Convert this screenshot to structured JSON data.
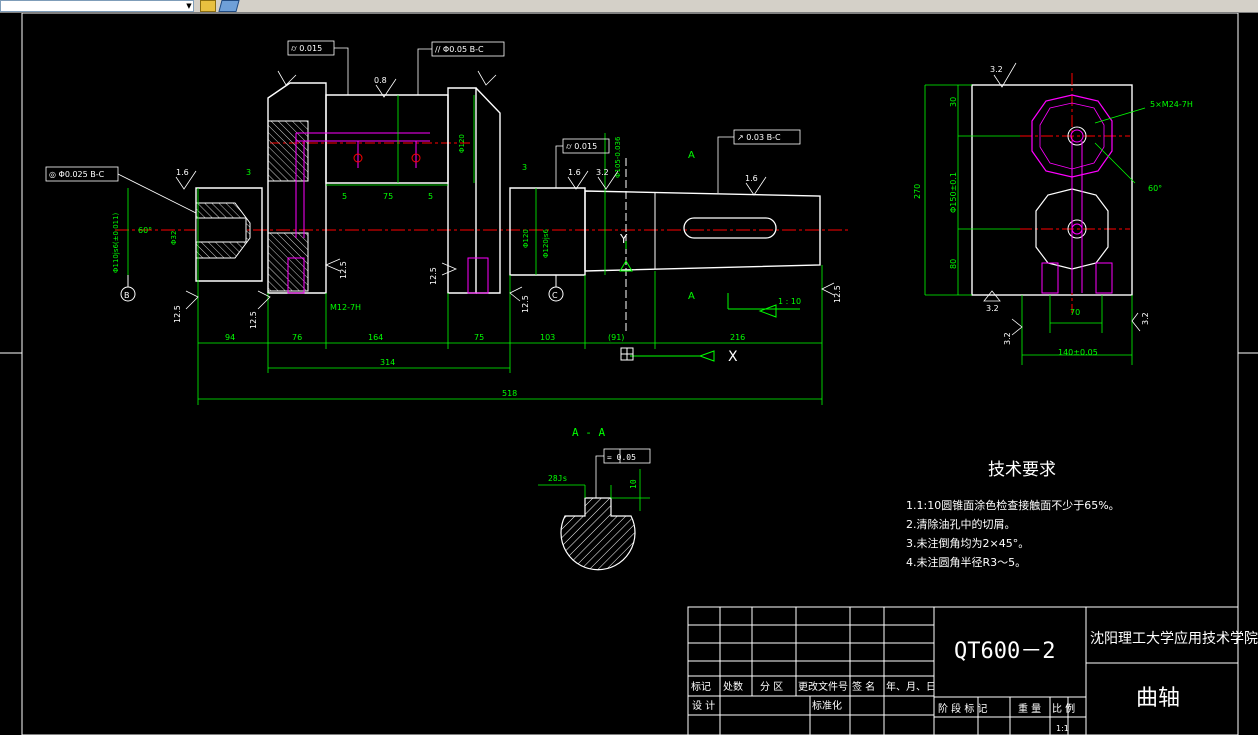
{
  "toolbar": {
    "icons": [
      "open-file-icon",
      "layer-icon"
    ]
  },
  "colors": {
    "background": "#000000",
    "outline": "#ffffff",
    "dimension": "#00ff00",
    "center_line": "#ff0000",
    "hidden": "#ff00ff",
    "hatch": "#ffffff"
  },
  "main_view": {
    "callouts": {
      "fcf_left": "◎ Φ0.025  B-C",
      "fcf_top1": "⌭ 0.015",
      "fcf_top2": "// Φ0.05  B-C",
      "fcf_mid": "⌭ 0.015",
      "fcf_right": "↗ 0.03  B-C"
    },
    "roughness": [
      "1.6",
      "0.8",
      "1.6",
      "3.2",
      "1.6",
      "12.5",
      "12.5",
      "12.5",
      "12.5",
      "12.5",
      "12.5"
    ],
    "datums": [
      "B",
      "C"
    ],
    "section_marks": [
      "A",
      "A"
    ],
    "thread_label": "M12-7H",
    "taper_label": "1 : 10",
    "dims_bottom": [
      "94",
      "76",
      "164",
      "75",
      "103",
      "(91)",
      "216"
    ],
    "dims_total": [
      "314",
      "518"
    ],
    "dims_small": [
      "3",
      "5",
      "75",
      "5",
      "3"
    ],
    "dims_vertical": [
      "Φ110js6(±0.011)",
      "Φ32",
      "Φ120",
      "Φ120js6",
      "Φ120",
      "Φ105-0.036"
    ],
    "angle_label": "60°"
  },
  "side_view": {
    "roughness_top": "3.2",
    "roughness_bottom": [
      "3.2",
      "3.2",
      "3.2"
    ],
    "dims": [
      "270",
      "30",
      "Φ150±0.1",
      "80",
      "70",
      "140±0.05"
    ],
    "hole_label": "5×M24-7H",
    "angle_label": "60°"
  },
  "section_view": {
    "title": "A - A",
    "fcf": "= 0.05",
    "keyway": "28Js",
    "depth": "10"
  },
  "tech_req": {
    "title": "技术要求",
    "items": [
      "1.1:10圆锥面涂色检查接触面不少于65%。",
      "2.清除油孔中的切屑。",
      "3.未注倒角均为2×45°。",
      "4.未注圆角半径R3～5。"
    ]
  },
  "title_block": {
    "material": "QT600－2",
    "school": "沈阳理工大学应用技术学院",
    "part_name": "曲轴",
    "row_labels": [
      "标记",
      "处数",
      "分 区",
      "更改文件号",
      "签 名",
      "年、月、日"
    ],
    "design": "设 计",
    "standard": "标准化",
    "stage_labels": [
      "阶 段 标 记",
      "重 量",
      "比 例"
    ],
    "scale": "1:1"
  }
}
